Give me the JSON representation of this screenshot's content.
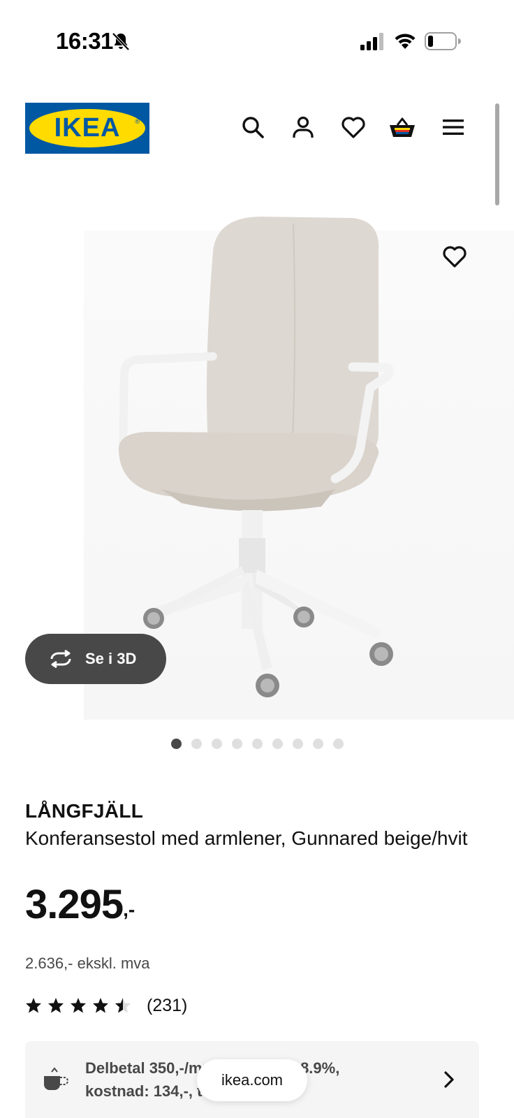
{
  "status_bar": {
    "time": "16:31",
    "icons": [
      "bell-slash-icon",
      "signal-icon",
      "wifi-icon",
      "battery-icon"
    ]
  },
  "header": {
    "logo_text": "IKEA",
    "logo_registered": "®",
    "icons": [
      "search-icon",
      "account-icon",
      "heart-icon",
      "shopping-bag-icon",
      "menu-icon"
    ]
  },
  "gallery": {
    "view_3d_label": "Se i 3D",
    "dot_count": 9,
    "active_dot": 1
  },
  "product": {
    "name": "LÅNGFJÄLL",
    "description": "Konferansestol med armlener, Gunnared beige/hvit",
    "price": "3.295",
    "price_suffix": ",-",
    "price_ex_vat": "2.636,- ekskl. mva",
    "rating": 4.5,
    "rating_count": "(231)"
  },
  "financing": {
    "line1": "Delbetal 350,-/mnd. Eff. rente 8.9%,",
    "line2": "kostnad: 134,-, totalt 3.429,-"
  },
  "browser": {
    "url": "ikea.com"
  },
  "colors": {
    "ikea_blue": "#0058a3",
    "ikea_yellow": "#ffdb00",
    "pill_dark": "#484848"
  }
}
